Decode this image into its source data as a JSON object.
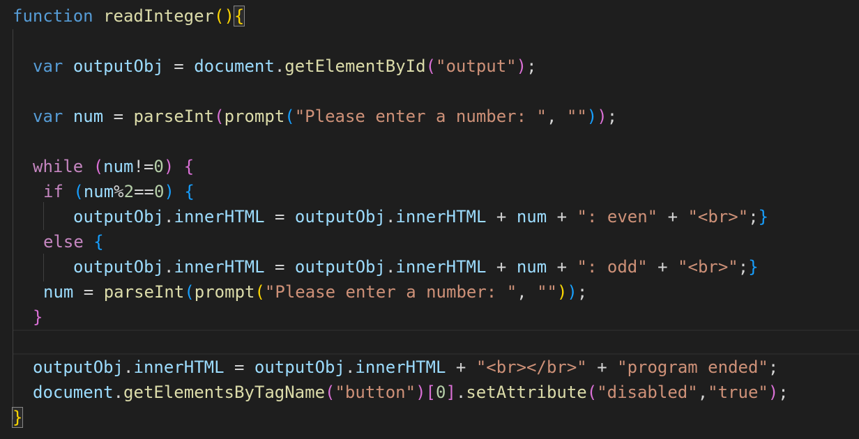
{
  "editor": {
    "lines": [
      {
        "indent": 18,
        "tokens": [
          {
            "t": "function",
            "c": "kw"
          },
          {
            "t": " ",
            "c": "op"
          },
          {
            "t": "readInteger",
            "c": "fn"
          },
          {
            "t": "(",
            "c": "b1"
          },
          {
            "t": ")",
            "c": "b1"
          },
          {
            "t": "{",
            "c": "b1 match"
          }
        ]
      },
      {
        "indent": 47,
        "tokens": []
      },
      {
        "indent": 47,
        "tokens": [
          {
            "t": "var",
            "c": "kw"
          },
          {
            "t": " ",
            "c": "op"
          },
          {
            "t": "outputObj",
            "c": "var"
          },
          {
            "t": " = ",
            "c": "op"
          },
          {
            "t": "document",
            "c": "var"
          },
          {
            "t": ".",
            "c": "op"
          },
          {
            "t": "getElementById",
            "c": "fn"
          },
          {
            "t": "(",
            "c": "b2"
          },
          {
            "t": "\"output\"",
            "c": "str"
          },
          {
            "t": ")",
            "c": "b2"
          },
          {
            "t": ";",
            "c": "op"
          }
        ]
      },
      {
        "indent": 47,
        "tokens": []
      },
      {
        "indent": 47,
        "tokens": [
          {
            "t": "var",
            "c": "kw"
          },
          {
            "t": " ",
            "c": "op"
          },
          {
            "t": "num",
            "c": "var"
          },
          {
            "t": " = ",
            "c": "op"
          },
          {
            "t": "parseInt",
            "c": "fn"
          },
          {
            "t": "(",
            "c": "b2"
          },
          {
            "t": "prompt",
            "c": "fn"
          },
          {
            "t": "(",
            "c": "b3"
          },
          {
            "t": "\"Please enter a number: \"",
            "c": "str"
          },
          {
            "t": ", ",
            "c": "op"
          },
          {
            "t": "\"\"",
            "c": "str"
          },
          {
            "t": ")",
            "c": "b3"
          },
          {
            "t": ")",
            "c": "b2"
          },
          {
            "t": ";",
            "c": "op"
          }
        ]
      },
      {
        "indent": 47,
        "tokens": []
      },
      {
        "indent": 47,
        "tokens": [
          {
            "t": "while",
            "c": "ctl"
          },
          {
            "t": " ",
            "c": "op"
          },
          {
            "t": "(",
            "c": "b2"
          },
          {
            "t": "num",
            "c": "var"
          },
          {
            "t": "!=",
            "c": "op"
          },
          {
            "t": "0",
            "c": "num"
          },
          {
            "t": ")",
            "c": "b2"
          },
          {
            "t": " ",
            "c": "op"
          },
          {
            "t": "{",
            "c": "b2"
          }
        ]
      },
      {
        "indent": 62,
        "tokens": [
          {
            "t": "if",
            "c": "ctl"
          },
          {
            "t": " ",
            "c": "op"
          },
          {
            "t": "(",
            "c": "b3"
          },
          {
            "t": "num",
            "c": "var"
          },
          {
            "t": "%",
            "c": "op"
          },
          {
            "t": "2",
            "c": "num"
          },
          {
            "t": "==",
            "c": "op"
          },
          {
            "t": "0",
            "c": "num"
          },
          {
            "t": ")",
            "c": "b3"
          },
          {
            "t": " ",
            "c": "op"
          },
          {
            "t": "{",
            "c": "b3"
          }
        ]
      },
      {
        "indent": 105,
        "tokens": [
          {
            "t": "outputObj",
            "c": "var"
          },
          {
            "t": ".",
            "c": "op"
          },
          {
            "t": "innerHTML",
            "c": "var"
          },
          {
            "t": " = ",
            "c": "op"
          },
          {
            "t": "outputObj",
            "c": "var"
          },
          {
            "t": ".",
            "c": "op"
          },
          {
            "t": "innerHTML",
            "c": "var"
          },
          {
            "t": " + ",
            "c": "op"
          },
          {
            "t": "num",
            "c": "var"
          },
          {
            "t": " + ",
            "c": "op"
          },
          {
            "t": "\": even\"",
            "c": "str"
          },
          {
            "t": " + ",
            "c": "op"
          },
          {
            "t": "\"<br>\"",
            "c": "str"
          },
          {
            "t": ";",
            "c": "op"
          },
          {
            "t": "}",
            "c": "b3"
          }
        ]
      },
      {
        "indent": 62,
        "tokens": [
          {
            "t": "else",
            "c": "ctl"
          },
          {
            "t": " ",
            "c": "op"
          },
          {
            "t": "{",
            "c": "b3"
          }
        ]
      },
      {
        "indent": 105,
        "tokens": [
          {
            "t": "outputObj",
            "c": "var"
          },
          {
            "t": ".",
            "c": "op"
          },
          {
            "t": "innerHTML",
            "c": "var"
          },
          {
            "t": " = ",
            "c": "op"
          },
          {
            "t": "outputObj",
            "c": "var"
          },
          {
            "t": ".",
            "c": "op"
          },
          {
            "t": "innerHTML",
            "c": "var"
          },
          {
            "t": " + ",
            "c": "op"
          },
          {
            "t": "num",
            "c": "var"
          },
          {
            "t": " + ",
            "c": "op"
          },
          {
            "t": "\": odd\"",
            "c": "str"
          },
          {
            "t": " + ",
            "c": "op"
          },
          {
            "t": "\"<br>\"",
            "c": "str"
          },
          {
            "t": ";",
            "c": "op"
          },
          {
            "t": "}",
            "c": "b3"
          }
        ]
      },
      {
        "indent": 62,
        "tokens": [
          {
            "t": "num",
            "c": "var"
          },
          {
            "t": " = ",
            "c": "op"
          },
          {
            "t": "parseInt",
            "c": "fn"
          },
          {
            "t": "(",
            "c": "b3"
          },
          {
            "t": "prompt",
            "c": "fn"
          },
          {
            "t": "(",
            "c": "b1"
          },
          {
            "t": "\"Please enter a number: \"",
            "c": "str"
          },
          {
            "t": ", ",
            "c": "op"
          },
          {
            "t": "\"\"",
            "c": "str"
          },
          {
            "t": ")",
            "c": "b1"
          },
          {
            "t": ")",
            "c": "b3"
          },
          {
            "t": ";",
            "c": "op"
          }
        ]
      },
      {
        "indent": 47,
        "tokens": [
          {
            "t": "}",
            "c": "b2"
          }
        ]
      },
      {
        "indent": 47,
        "tokens": []
      },
      {
        "indent": 47,
        "tokens": [
          {
            "t": "outputObj",
            "c": "var"
          },
          {
            "t": ".",
            "c": "op"
          },
          {
            "t": "innerHTML",
            "c": "var"
          },
          {
            "t": " = ",
            "c": "op"
          },
          {
            "t": "outputObj",
            "c": "var"
          },
          {
            "t": ".",
            "c": "op"
          },
          {
            "t": "innerHTML",
            "c": "var"
          },
          {
            "t": " + ",
            "c": "op"
          },
          {
            "t": "\"<br></br>\"",
            "c": "str"
          },
          {
            "t": " + ",
            "c": "op"
          },
          {
            "t": "\"program ended\"",
            "c": "str"
          },
          {
            "t": ";",
            "c": "op"
          }
        ]
      },
      {
        "indent": 47,
        "tokens": [
          {
            "t": "document",
            "c": "var"
          },
          {
            "t": ".",
            "c": "op"
          },
          {
            "t": "getElementsByTagName",
            "c": "fn"
          },
          {
            "t": "(",
            "c": "b2"
          },
          {
            "t": "\"button\"",
            "c": "str"
          },
          {
            "t": ")",
            "c": "b2"
          },
          {
            "t": "[",
            "c": "b2"
          },
          {
            "t": "0",
            "c": "num"
          },
          {
            "t": "]",
            "c": "b2"
          },
          {
            "t": ".",
            "c": "op"
          },
          {
            "t": "setAttribute",
            "c": "fn"
          },
          {
            "t": "(",
            "c": "b2"
          },
          {
            "t": "\"disabled\"",
            "c": "str"
          },
          {
            "t": ",",
            "c": "op"
          },
          {
            "t": "\"true\"",
            "c": "str"
          },
          {
            "t": ")",
            "c": "b2"
          },
          {
            "t": ";",
            "c": "op"
          }
        ]
      },
      {
        "indent": 18,
        "tokens": [
          {
            "t": "}",
            "c": "b1 match"
          }
        ]
      }
    ]
  }
}
